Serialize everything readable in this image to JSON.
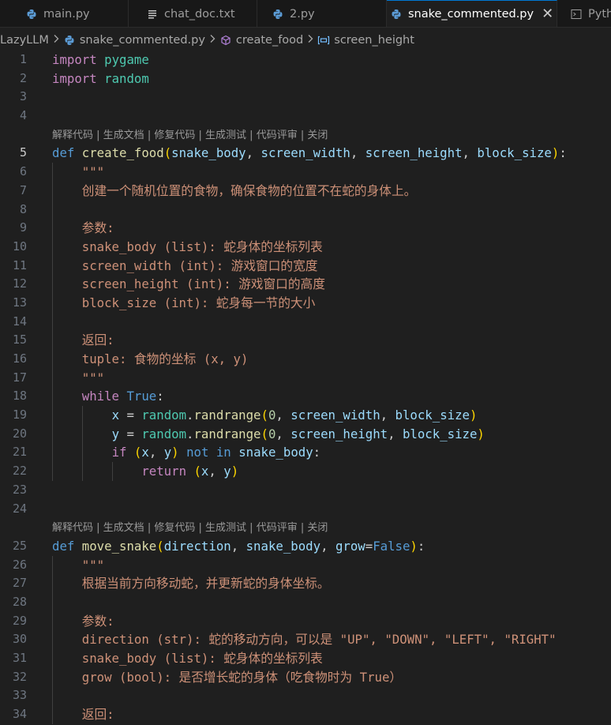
{
  "tabs": [
    {
      "label": "main.py",
      "icon": "python-icon",
      "active": false
    },
    {
      "label": "chat_doc.txt",
      "icon": "text-file-icon",
      "active": false
    },
    {
      "label": "2.py",
      "icon": "python-icon",
      "active": false
    },
    {
      "label": "snake_commented.py",
      "icon": "python-icon",
      "active": true
    },
    {
      "label": "Pyth",
      "icon": "terminal-icon",
      "active": false
    }
  ],
  "breadcrumb": {
    "folder": "LazyLLM",
    "file": "snake_commented.py",
    "function": "create_food",
    "variable": "screen_height"
  },
  "codelens": {
    "explain": "解释代码",
    "gen_doc": "生成文档",
    "fix": "修复代码",
    "gen_test": "生成测试",
    "review": "代码评审",
    "close": "关闭",
    "sep": " | "
  },
  "current_line": 5,
  "lines": [
    {
      "n": 1,
      "indent": 0,
      "tokens": [
        [
          "kw",
          "import"
        ],
        [
          "plain",
          " "
        ],
        [
          "mod",
          "pygame"
        ]
      ]
    },
    {
      "n": 2,
      "indent": 0,
      "tokens": [
        [
          "kw",
          "import"
        ],
        [
          "plain",
          " "
        ],
        [
          "mod",
          "random"
        ]
      ]
    },
    {
      "n": 3,
      "indent": 0,
      "tokens": []
    },
    {
      "n": 4,
      "indent": 0,
      "tokens": [],
      "lens_after": true
    },
    {
      "n": 5,
      "indent": 0,
      "tokens": [
        [
          "kw2",
          "def"
        ],
        [
          "plain",
          " "
        ],
        [
          "fn",
          "create_food"
        ],
        [
          "p1",
          "("
        ],
        [
          "var",
          "snake_body"
        ],
        [
          "plain",
          ", "
        ],
        [
          "var",
          "screen_width"
        ],
        [
          "plain",
          ", "
        ],
        [
          "var",
          "screen_height"
        ],
        [
          "plain",
          ", "
        ],
        [
          "var",
          "block_size"
        ],
        [
          "p1",
          ")"
        ],
        [
          "plain",
          ":"
        ]
      ]
    },
    {
      "n": 6,
      "indent": 1,
      "tokens": [
        [
          "str",
          "    \"\"\""
        ]
      ]
    },
    {
      "n": 7,
      "indent": 1,
      "tokens": [
        [
          "str",
          "    创建一个随机位置的食物，确保食物的位置不在蛇的身体上。"
        ]
      ]
    },
    {
      "n": 8,
      "indent": 1,
      "tokens": []
    },
    {
      "n": 9,
      "indent": 1,
      "tokens": [
        [
          "str",
          "    参数:"
        ]
      ]
    },
    {
      "n": 10,
      "indent": 1,
      "tokens": [
        [
          "str",
          "    snake_body (list): 蛇身体的坐标列表"
        ]
      ]
    },
    {
      "n": 11,
      "indent": 1,
      "tokens": [
        [
          "str",
          "    screen_width (int): 游戏窗口的宽度"
        ]
      ]
    },
    {
      "n": 12,
      "indent": 1,
      "tokens": [
        [
          "str",
          "    screen_height (int): 游戏窗口的高度"
        ]
      ]
    },
    {
      "n": 13,
      "indent": 1,
      "tokens": [
        [
          "str",
          "    block_size (int): 蛇身每一节的大小"
        ]
      ]
    },
    {
      "n": 14,
      "indent": 1,
      "tokens": []
    },
    {
      "n": 15,
      "indent": 1,
      "tokens": [
        [
          "str",
          "    返回:"
        ]
      ]
    },
    {
      "n": 16,
      "indent": 1,
      "tokens": [
        [
          "str",
          "    tuple: 食物的坐标 (x, y)"
        ]
      ]
    },
    {
      "n": 17,
      "indent": 1,
      "tokens": [
        [
          "str",
          "    \"\"\""
        ]
      ]
    },
    {
      "n": 18,
      "indent": 1,
      "tokens": [
        [
          "plain",
          "    "
        ],
        [
          "kw",
          "while"
        ],
        [
          "plain",
          " "
        ],
        [
          "kw2",
          "True"
        ],
        [
          "plain",
          ":"
        ]
      ]
    },
    {
      "n": 19,
      "indent": 2,
      "tokens": [
        [
          "plain",
          "        "
        ],
        [
          "var",
          "x"
        ],
        [
          "plain",
          " = "
        ],
        [
          "mod",
          "random"
        ],
        [
          "plain",
          "."
        ],
        [
          "fn",
          "randrange"
        ],
        [
          "p1",
          "("
        ],
        [
          "num",
          "0"
        ],
        [
          "plain",
          ", "
        ],
        [
          "var",
          "screen_width"
        ],
        [
          "plain",
          ", "
        ],
        [
          "var",
          "block_size"
        ],
        [
          "p1",
          ")"
        ]
      ]
    },
    {
      "n": 20,
      "indent": 2,
      "tokens": [
        [
          "plain",
          "        "
        ],
        [
          "var",
          "y"
        ],
        [
          "plain",
          " = "
        ],
        [
          "mod",
          "random"
        ],
        [
          "plain",
          "."
        ],
        [
          "fn",
          "randrange"
        ],
        [
          "p1",
          "("
        ],
        [
          "num",
          "0"
        ],
        [
          "plain",
          ", "
        ],
        [
          "var",
          "screen_height"
        ],
        [
          "plain",
          ", "
        ],
        [
          "var",
          "block_size"
        ],
        [
          "p1",
          ")"
        ]
      ]
    },
    {
      "n": 21,
      "indent": 2,
      "tokens": [
        [
          "plain",
          "        "
        ],
        [
          "kw",
          "if"
        ],
        [
          "plain",
          " "
        ],
        [
          "p1",
          "("
        ],
        [
          "var",
          "x"
        ],
        [
          "plain",
          ", "
        ],
        [
          "var",
          "y"
        ],
        [
          "p1",
          ")"
        ],
        [
          "plain",
          " "
        ],
        [
          "kw2",
          "not"
        ],
        [
          "plain",
          " "
        ],
        [
          "kw2",
          "in"
        ],
        [
          "plain",
          " "
        ],
        [
          "var",
          "snake_body"
        ],
        [
          "plain",
          ":"
        ]
      ]
    },
    {
      "n": 22,
      "indent": 3,
      "tokens": [
        [
          "plain",
          "            "
        ],
        [
          "kw",
          "return"
        ],
        [
          "plain",
          " "
        ],
        [
          "p1",
          "("
        ],
        [
          "var",
          "x"
        ],
        [
          "plain",
          ", "
        ],
        [
          "var",
          "y"
        ],
        [
          "p1",
          ")"
        ]
      ]
    },
    {
      "n": 23,
      "indent": 0,
      "tokens": []
    },
    {
      "n": 24,
      "indent": 0,
      "tokens": [],
      "lens_after": true
    },
    {
      "n": 25,
      "indent": 0,
      "tokens": [
        [
          "kw2",
          "def"
        ],
        [
          "plain",
          " "
        ],
        [
          "fn",
          "move_snake"
        ],
        [
          "p1",
          "("
        ],
        [
          "var",
          "direction"
        ],
        [
          "plain",
          ", "
        ],
        [
          "var",
          "snake_body"
        ],
        [
          "plain",
          ", "
        ],
        [
          "var",
          "grow"
        ],
        [
          "plain",
          "="
        ],
        [
          "kw2",
          "False"
        ],
        [
          "p1",
          ")"
        ],
        [
          "plain",
          ":"
        ]
      ]
    },
    {
      "n": 26,
      "indent": 1,
      "tokens": [
        [
          "str",
          "    \"\"\""
        ]
      ]
    },
    {
      "n": 27,
      "indent": 1,
      "tokens": [
        [
          "str",
          "    根据当前方向移动蛇，并更新蛇的身体坐标。"
        ]
      ]
    },
    {
      "n": 28,
      "indent": 1,
      "tokens": []
    },
    {
      "n": 29,
      "indent": 1,
      "tokens": [
        [
          "str",
          "    参数:"
        ]
      ]
    },
    {
      "n": 30,
      "indent": 1,
      "tokens": [
        [
          "str",
          "    direction (str): 蛇的移动方向，可以是 \"UP\", \"DOWN\", \"LEFT\", \"RIGHT\""
        ]
      ]
    },
    {
      "n": 31,
      "indent": 1,
      "tokens": [
        [
          "str",
          "    snake_body (list): 蛇身体的坐标列表"
        ]
      ]
    },
    {
      "n": 32,
      "indent": 1,
      "tokens": [
        [
          "str",
          "    grow (bool): 是否增长蛇的身体（吃食物时为 True）"
        ]
      ]
    },
    {
      "n": 33,
      "indent": 1,
      "tokens": []
    },
    {
      "n": 34,
      "indent": 1,
      "tokens": [
        [
          "str",
          "    返回:"
        ]
      ]
    }
  ]
}
